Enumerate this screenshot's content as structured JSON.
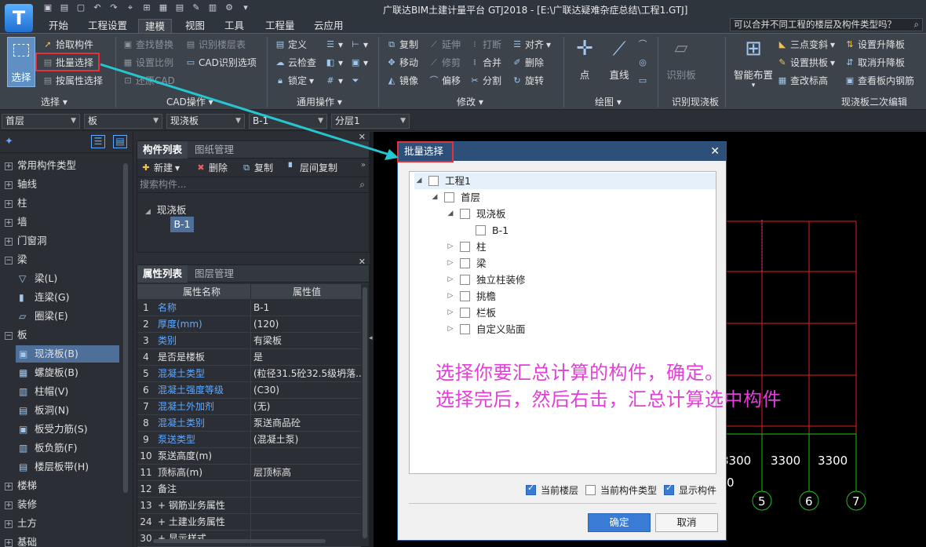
{
  "app": {
    "logo_letter": "T",
    "window_title": "广联达BIM土建计量平台 GTJ2018 - [E:\\广联达疑难杂症总结\\工程1.GTJ]"
  },
  "menu": {
    "tabs": [
      "开始",
      "工程设置",
      "建模",
      "视图",
      "工具",
      "工程量",
      "云应用"
    ],
    "active": "建模",
    "help_search": "可以合并不同工程的楼层及构件类型吗？"
  },
  "ribbon": {
    "select_group": {
      "big_select": "选择",
      "pick": "拾取构件",
      "batch_select": "批量选择",
      "by_attr": "按属性选择",
      "label": "选择"
    },
    "cad_group": {
      "find_replace": "查找替换",
      "identify_floors": "识别楼层表",
      "set_scale": "设置比例",
      "cad_options": "CAD识别选项",
      "restore_cad": "还原CAD",
      "label": "CAD操作"
    },
    "common_group": {
      "define": "定义",
      "cloud_check": "云检查",
      "lock": "锁定",
      "label": "通用操作"
    },
    "modify_group": {
      "copy": "复制",
      "extend": "延伸",
      "break": "打断",
      "align": "对齐",
      "move": "移动",
      "trim": "修剪",
      "merge": "合并",
      "delete": "删除",
      "mirror": "镜像",
      "offset": "偏移",
      "split": "分割",
      "rotate": "旋转",
      "label": "修改"
    },
    "draw_group": {
      "point": "点",
      "line": "直线",
      "label": "绘图"
    },
    "identify_group": {
      "identify_slab": "识别板",
      "label": "识别现浇板"
    },
    "slab_edit_group": {
      "smart_layout": "智能布置",
      "three_point_slope": "三点变斜",
      "set_arch": "设置拱板",
      "check_elevation": "查改标高",
      "set_raise": "设置升降板",
      "cancel_raise": "取消升降板",
      "view_rebar": "查看板内钢筋",
      "label": "现浇板二次编辑"
    }
  },
  "selectors": {
    "floor": "首层",
    "category": "板",
    "type": "现浇板",
    "component": "B-1",
    "layer": "分层1"
  },
  "left_tree": [
    {
      "label": "常用构件类型",
      "kind": "group"
    },
    {
      "label": "轴线",
      "kind": "group"
    },
    {
      "label": "柱",
      "kind": "group"
    },
    {
      "label": "墙",
      "kind": "group"
    },
    {
      "label": "门窗洞",
      "kind": "group"
    },
    {
      "label": "梁",
      "kind": "group-open"
    },
    {
      "label": "梁(L)",
      "kind": "child"
    },
    {
      "label": "连梁(G)",
      "kind": "child"
    },
    {
      "label": "圈梁(E)",
      "kind": "child"
    },
    {
      "label": "板",
      "kind": "group-open"
    },
    {
      "label": "现浇板(B)",
      "kind": "child",
      "selected": true
    },
    {
      "label": "螺旋板(B)",
      "kind": "child"
    },
    {
      "label": "柱帽(V)",
      "kind": "child"
    },
    {
      "label": "板洞(N)",
      "kind": "child"
    },
    {
      "label": "板受力筋(S)",
      "kind": "child"
    },
    {
      "label": "板负筋(F)",
      "kind": "child"
    },
    {
      "label": "楼层板带(H)",
      "kind": "child"
    },
    {
      "label": "楼梯",
      "kind": "group"
    },
    {
      "label": "装修",
      "kind": "group"
    },
    {
      "label": "土方",
      "kind": "group"
    },
    {
      "label": "基础",
      "kind": "group"
    }
  ],
  "component_panel": {
    "tabs": [
      "构件列表",
      "图纸管理"
    ],
    "actions": {
      "new": "新建",
      "delete": "删除",
      "copy": "复制",
      "floor_copy": "层间复制"
    },
    "search_placeholder": "搜索构件...",
    "tree_parent": "现浇板",
    "tree_child": "B-1"
  },
  "property_panel": {
    "tabs": [
      "属性列表",
      "图层管理"
    ],
    "col_name": "属性名称",
    "col_value": "属性值",
    "rows": [
      {
        "n": "1",
        "k": "名称",
        "v": "B-1",
        "blue": true
      },
      {
        "n": "2",
        "k": "厚度(mm)",
        "v": "(120)",
        "blue": true
      },
      {
        "n": "3",
        "k": "类别",
        "v": "有梁板",
        "blue": true
      },
      {
        "n": "4",
        "k": "是否是楼板",
        "v": "是",
        "blue": false
      },
      {
        "n": "5",
        "k": "混凝土类型",
        "v": "(粒径31.5砼32.5级坍落...",
        "blue": true
      },
      {
        "n": "6",
        "k": "混凝土强度等级",
        "v": "(C30)",
        "blue": true
      },
      {
        "n": "7",
        "k": "混凝土外加剂",
        "v": "(无)",
        "blue": true
      },
      {
        "n": "8",
        "k": "混凝土类别",
        "v": "泵送商品砼",
        "blue": true
      },
      {
        "n": "9",
        "k": "泵送类型",
        "v": "(混凝土泵)",
        "blue": true
      },
      {
        "n": "10",
        "k": "泵送高度(m)",
        "v": "",
        "blue": false
      },
      {
        "n": "11",
        "k": "顶标高(m)",
        "v": "层顶标高",
        "blue": false
      },
      {
        "n": "12",
        "k": "备注",
        "v": "",
        "blue": false
      },
      {
        "n": "13",
        "k": "+  钢筋业务属性",
        "v": "",
        "blue": false
      },
      {
        "n": "24",
        "k": "+  土建业务属性",
        "v": "",
        "blue": false
      },
      {
        "n": "30",
        "k": "+  显示样式",
        "v": "",
        "blue": false
      }
    ]
  },
  "dialog": {
    "title": "批量选择",
    "tree": [
      {
        "label": "工程1",
        "level": 0,
        "twisty": "open"
      },
      {
        "label": "首层",
        "level": 1,
        "twisty": "open"
      },
      {
        "label": "现浇板",
        "level": 2,
        "twisty": "open"
      },
      {
        "label": "B-1",
        "level": 3,
        "twisty": "none"
      },
      {
        "label": "柱",
        "level": 2,
        "twisty": "closed"
      },
      {
        "label": "梁",
        "level": 2,
        "twisty": "closed"
      },
      {
        "label": "独立柱装修",
        "level": 2,
        "twisty": "closed"
      },
      {
        "label": "挑檐",
        "level": 2,
        "twisty": "closed"
      },
      {
        "label": "栏板",
        "level": 2,
        "twisty": "closed"
      },
      {
        "label": "自定义贴面",
        "level": 2,
        "twisty": "closed"
      }
    ],
    "note_line1": "选择你要汇总计算的构件，确定。",
    "note_line2": "选择完后，然后右击，汇总计算选中构件",
    "options": [
      {
        "label": "当前楼层",
        "checked": true
      },
      {
        "label": "当前构件类型",
        "checked": false
      },
      {
        "label": "显示构件",
        "checked": true
      }
    ],
    "ok": "确定",
    "cancel": "取消"
  },
  "canvas": {
    "dims": [
      "3300",
      "3300",
      "3300"
    ],
    "partial_dim": "0",
    "axes": [
      "5",
      "6",
      "7"
    ],
    "colors": {
      "grid": "#e02020",
      "dim": "#ffffff",
      "axis": "#20c020"
    }
  },
  "annotation_colors": {
    "arrow": "#26c6d0",
    "highlight": "#e3323b",
    "note": "#e040d8"
  }
}
